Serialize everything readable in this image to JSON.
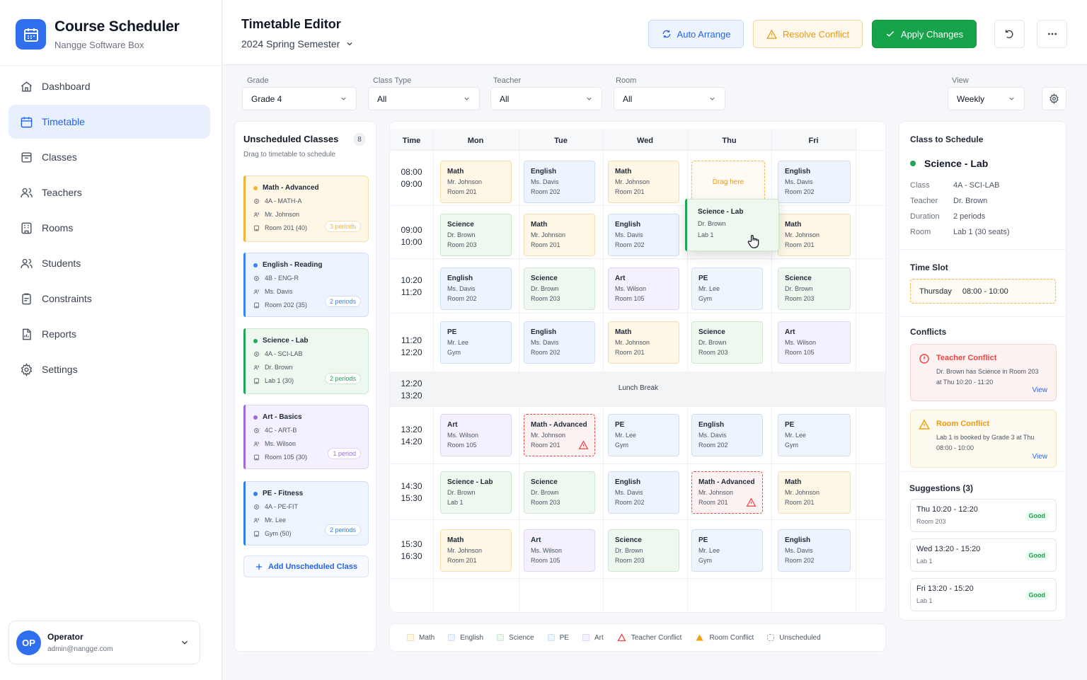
{
  "app": {
    "title": "Course Scheduler",
    "subtitle": "Nangge Software Box"
  },
  "nav": [
    {
      "label": "Dashboard",
      "icon": "home-icon"
    },
    {
      "label": "Timetable",
      "icon": "calendar-icon",
      "active": true
    },
    {
      "label": "Classes",
      "icon": "book-icon"
    },
    {
      "label": "Teachers",
      "icon": "users-icon"
    },
    {
      "label": "Rooms",
      "icon": "building-icon"
    },
    {
      "label": "Students",
      "icon": "users-icon"
    },
    {
      "label": "Constraints",
      "icon": "clipboard-icon"
    },
    {
      "label": "Reports",
      "icon": "report-icon"
    },
    {
      "label": "Settings",
      "icon": "gear-icon"
    }
  ],
  "user": {
    "initials": "OP",
    "name": "Operator",
    "email": "admin@nangge.com"
  },
  "header": {
    "title": "Timetable Editor",
    "semester": "2024 Spring Semester",
    "auto_arrange": "Auto Arrange",
    "resolve_conflict": "Resolve Conflict",
    "apply_changes": "Apply Changes"
  },
  "filters": {
    "grade": {
      "label": "Grade",
      "value": "Grade 4"
    },
    "class_type": {
      "label": "Class Type",
      "value": "All"
    },
    "teacher": {
      "label": "Teacher",
      "value": "All"
    },
    "room": {
      "label": "Room",
      "value": "All"
    },
    "view": {
      "label": "View",
      "value": "Weekly"
    }
  },
  "unscheduled": {
    "title": "Unscheduled Classes",
    "count": "8",
    "hint": "Drag to timetable to schedule",
    "add_label": "Add Unscheduled Class",
    "items": [
      {
        "name": "Math - Advanced",
        "code": "4A - MATH-A",
        "teacher": "Mr. Johnson",
        "room": "Room 201 (40)",
        "periods": "3 periods",
        "type": "math"
      },
      {
        "name": "English - Reading",
        "code": "4B - ENG-R",
        "teacher": "Ms. Davis",
        "room": "Room 202 (35)",
        "periods": "2 periods",
        "type": "english"
      },
      {
        "name": "Science - Lab",
        "code": "4A - SCI-LAB",
        "teacher": "Dr. Brown",
        "room": "Lab 1 (30)",
        "periods": "2 periods",
        "type": "science"
      },
      {
        "name": "Art - Basics",
        "code": "4C - ART-B",
        "teacher": "Ms. Wilson",
        "room": "Room 105 (30)",
        "periods": "1 period",
        "type": "art"
      },
      {
        "name": "PE - Fitness",
        "code": "4A - PE-FIT",
        "teacher": "Mr. Lee",
        "room": "Gym (50)",
        "periods": "2 periods",
        "type": "pe"
      }
    ]
  },
  "timetable": {
    "time_header": "Time",
    "days": [
      "Mon",
      "Tue",
      "Wed",
      "Thu",
      "Fri"
    ],
    "slots": [
      {
        "start": "08:00",
        "end": "09:00"
      },
      {
        "start": "09:00",
        "end": "10:00"
      },
      {
        "start": "10:20",
        "end": "11:20"
      },
      {
        "start": "11:20",
        "end": "12:20"
      },
      {
        "start": "12:20",
        "end": "13:20"
      },
      {
        "start": "13:20",
        "end": "14:20"
      },
      {
        "start": "14:30",
        "end": "15:30"
      },
      {
        "start": "15:30",
        "end": "16:30"
      }
    ],
    "lunch_label": "Lunch Break",
    "drag_here": "Drag here",
    "cells": [
      {
        "row": 0,
        "day": 0,
        "subject": "Math",
        "teacher": "Mr. Johnson",
        "room": "Room 201",
        "type": "math"
      },
      {
        "row": 0,
        "day": 1,
        "subject": "English",
        "teacher": "Ms. Davis",
        "room": "Room 202",
        "type": "english"
      },
      {
        "row": 0,
        "day": 2,
        "subject": "Math",
        "teacher": "Mr. Johnson",
        "room": "Room 201",
        "type": "math"
      },
      {
        "row": 0,
        "day": 4,
        "subject": "English",
        "teacher": "Ms. Davis",
        "room": "Room 202",
        "type": "english"
      },
      {
        "row": 1,
        "day": 0,
        "subject": "Science",
        "teacher": "Dr. Brown",
        "room": "Room 203",
        "type": "science"
      },
      {
        "row": 1,
        "day": 1,
        "subject": "Math",
        "teacher": "Mr. Johnson",
        "room": "Room 201",
        "type": "math"
      },
      {
        "row": 1,
        "day": 2,
        "subject": "English",
        "teacher": "Ms. Davis",
        "room": "Room 202",
        "type": "english"
      },
      {
        "row": 1,
        "day": 4,
        "subject": "Math",
        "teacher": "Mr. Johnson",
        "room": "Room 201",
        "type": "math"
      },
      {
        "row": 2,
        "day": 0,
        "subject": "English",
        "teacher": "Ms. Davis",
        "room": "Room 202",
        "type": "english"
      },
      {
        "row": 2,
        "day": 1,
        "subject": "Science",
        "teacher": "Dr. Brown",
        "room": "Room 203",
        "type": "science"
      },
      {
        "row": 2,
        "day": 2,
        "subject": "Art",
        "teacher": "Ms. Wilson",
        "room": "Room 105",
        "type": "art"
      },
      {
        "row": 2,
        "day": 3,
        "subject": "PE",
        "teacher": "Mr. Lee",
        "room": "Gym",
        "type": "pe"
      },
      {
        "row": 2,
        "day": 4,
        "subject": "Science",
        "teacher": "Dr. Brown",
        "room": "Room 203",
        "type": "science"
      },
      {
        "row": 3,
        "day": 0,
        "subject": "PE",
        "teacher": "Mr. Lee",
        "room": "Gym",
        "type": "pe"
      },
      {
        "row": 3,
        "day": 1,
        "subject": "English",
        "teacher": "Ms. Davis",
        "room": "Room 202",
        "type": "english"
      },
      {
        "row": 3,
        "day": 2,
        "subject": "Math",
        "teacher": "Mr. Johnson",
        "room": "Room 201",
        "type": "math"
      },
      {
        "row": 3,
        "day": 3,
        "subject": "Science",
        "teacher": "Dr. Brown",
        "room": "Room 203",
        "type": "science"
      },
      {
        "row": 3,
        "day": 4,
        "subject": "Art",
        "teacher": "Ms. Wilson",
        "room": "Room 105",
        "type": "art"
      },
      {
        "row": 5,
        "day": 0,
        "subject": "Art",
        "teacher": "Ms. Wilson",
        "room": "Room 105",
        "type": "art"
      },
      {
        "row": 5,
        "day": 1,
        "subject": "Math - Advanced",
        "teacher": "Mr. Johnson",
        "room": "Room 201",
        "type": "conflict"
      },
      {
        "row": 5,
        "day": 2,
        "subject": "PE",
        "teacher": "Mr. Lee",
        "room": "Gym",
        "type": "pe"
      },
      {
        "row": 5,
        "day": 3,
        "subject": "English",
        "teacher": "Ms. Davis",
        "room": "Room 202",
        "type": "english"
      },
      {
        "row": 5,
        "day": 4,
        "subject": "PE",
        "teacher": "Mr. Lee",
        "room": "Gym",
        "type": "pe"
      },
      {
        "row": 6,
        "day": 0,
        "subject": "Science - Lab",
        "teacher": "Dr. Brown",
        "room": "Lab 1",
        "type": "science"
      },
      {
        "row": 6,
        "day": 1,
        "subject": "Science",
        "teacher": "Dr. Brown",
        "room": "Room 203",
        "type": "science"
      },
      {
        "row": 6,
        "day": 2,
        "subject": "English",
        "teacher": "Ms. Davis",
        "room": "Room 202",
        "type": "english"
      },
      {
        "row": 6,
        "day": 3,
        "subject": "Math - Advanced",
        "teacher": "Mr. Johnson",
        "room": "Room 201",
        "type": "conflict"
      },
      {
        "row": 6,
        "day": 4,
        "subject": "Math",
        "teacher": "Mr. Johnson",
        "room": "Room 201",
        "type": "math"
      },
      {
        "row": 7,
        "day": 0,
        "subject": "Math",
        "teacher": "Mr. Johnson",
        "room": "Room 201",
        "type": "math"
      },
      {
        "row": 7,
        "day": 1,
        "subject": "Art",
        "teacher": "Ms. Wilson",
        "room": "Room 105",
        "type": "art"
      },
      {
        "row": 7,
        "day": 2,
        "subject": "Science",
        "teacher": "Dr. Brown",
        "room": "Room 203",
        "type": "science"
      },
      {
        "row": 7,
        "day": 3,
        "subject": "PE",
        "teacher": "Mr. Lee",
        "room": "Gym",
        "type": "pe"
      },
      {
        "row": 7,
        "day": 4,
        "subject": "English",
        "teacher": "Ms. Davis",
        "room": "Room 202",
        "type": "english"
      }
    ],
    "dragging": {
      "subject": "Science - Lab",
      "teacher": "Dr. Brown",
      "room": "Lab 1"
    }
  },
  "legend": [
    {
      "label": "Math",
      "type": "math"
    },
    {
      "label": "English",
      "type": "english"
    },
    {
      "label": "Science",
      "type": "science"
    },
    {
      "label": "PE",
      "type": "pe"
    },
    {
      "label": "Art",
      "type": "art"
    },
    {
      "label": "Teacher Conflict",
      "type": "teacher-conflict"
    },
    {
      "label": "Room Conflict",
      "type": "room-conflict"
    },
    {
      "label": "Unscheduled",
      "type": "unscheduled"
    }
  ],
  "details": {
    "title": "Class to Schedule",
    "class_name": "Science - Lab",
    "rows": [
      {
        "key": "Class",
        "value": "4A - SCI-LAB"
      },
      {
        "key": "Teacher",
        "value": "Dr. Brown"
      },
      {
        "key": "Duration",
        "value": "2 periods"
      },
      {
        "key": "Room",
        "value": "Lab 1 (30 seats)"
      }
    ],
    "time_slot_title": "Time Slot",
    "time_slot_day": "Thursday",
    "time_slot_time": "08:00 - 10:00",
    "conflicts_title": "Conflicts",
    "conflicts": [
      {
        "title": "Teacher Conflict",
        "desc": "Dr. Brown has Science in Room 203 at Thu 10:20 - 11:20",
        "view": "View",
        "kind": "teacher"
      },
      {
        "title": "Room Conflict",
        "desc": "Lab 1 is booked by Grade 3 at Thu 08:00 - 10:00",
        "view": "View",
        "kind": "room"
      }
    ],
    "suggestions_title": "Suggestions (3)",
    "suggestions": [
      {
        "time": "Thu 10:20 - 12:20",
        "room": "Room 203",
        "rating": "Good"
      },
      {
        "time": "Wed 13:20 - 15:20",
        "room": "Lab 1",
        "rating": "Good"
      },
      {
        "time": "Fri 13:20 - 15:20",
        "room": "Lab 1",
        "rating": "Good"
      }
    ]
  },
  "colors": {
    "primary": "#2563eb",
    "success": "#16a34a",
    "warning": "#ea9a10",
    "danger": "#ef4444",
    "math": {
      "bg": "#fff7e6",
      "border": "#f6dfae",
      "accent": "#f4b13a"
    },
    "english": {
      "bg": "#eef4ff",
      "border": "#cfdef8",
      "accent": "#3b82f6"
    },
    "science": {
      "bg": "#eef8ef",
      "border": "#cde7d1",
      "accent": "#22a559"
    },
    "pe": {
      "bg": "#eef5fe",
      "border": "#cfe0f6",
      "accent": "#2f80ed"
    },
    "art": {
      "bg": "#f5f0fd",
      "border": "#e0d3f7",
      "accent": "#9b6bdf"
    }
  }
}
